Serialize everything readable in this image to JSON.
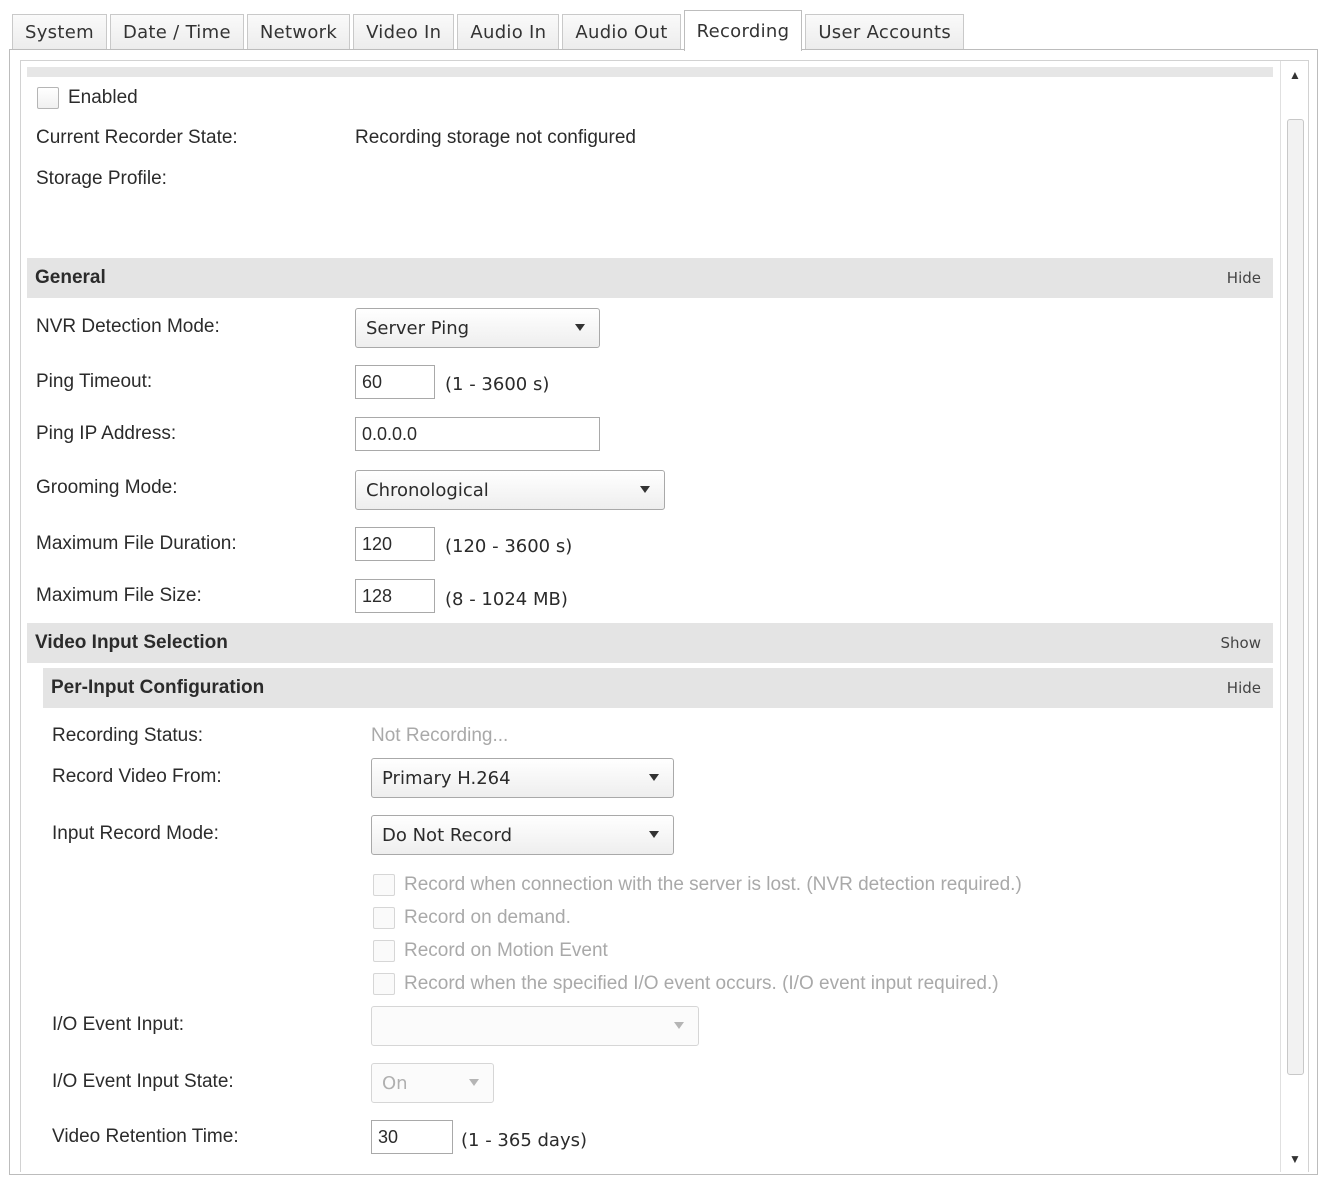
{
  "tabs": [
    {
      "label": "System",
      "active": false
    },
    {
      "label": "Date / Time",
      "active": false
    },
    {
      "label": "Network",
      "active": false
    },
    {
      "label": "Video In",
      "active": false
    },
    {
      "label": "Audio In",
      "active": false
    },
    {
      "label": "Audio Out",
      "active": false
    },
    {
      "label": "Recording",
      "active": true
    },
    {
      "label": "User Accounts",
      "active": false
    }
  ],
  "top": {
    "enabled_label": "Enabled",
    "recorder_state_label": "Current Recorder State:",
    "recorder_state_value": "Recording storage not configured",
    "storage_profile_label": "Storage Profile:"
  },
  "general": {
    "title": "General",
    "toggle": "Hide",
    "nvr_mode_label": "NVR Detection Mode:",
    "nvr_mode_value": "Server Ping",
    "ping_timeout_label": "Ping Timeout:",
    "ping_timeout_value": "60",
    "ping_timeout_range": "(1 - 3600 s)",
    "ping_ip_label": "Ping IP Address:",
    "ping_ip_value": "0.0.0.0",
    "grooming_label": "Grooming Mode:",
    "grooming_value": "Chronological",
    "max_duration_label": "Maximum File Duration:",
    "max_duration_value": "120",
    "max_duration_range": "(120 - 3600 s)",
    "max_size_label": "Maximum File Size:",
    "max_size_value": "128",
    "max_size_range": "(8 - 1024 MB)"
  },
  "video_input": {
    "title": "Video Input Selection",
    "toggle": "Show"
  },
  "per_input": {
    "title": "Per-Input Configuration",
    "toggle": "Hide",
    "status_label": "Recording Status:",
    "status_value": "Not Recording...",
    "record_from_label": "Record Video From:",
    "record_from_value": "Primary H.264",
    "record_mode_label": "Input Record Mode:",
    "record_mode_value": "Do Not Record",
    "options": [
      "Record when connection with the server is lost.  (NVR detection required.)",
      "Record on demand.",
      "Record on Motion Event",
      "Record when the specified I/O event occurs.  (I/O event input required.)"
    ],
    "io_input_label": "I/O Event Input:",
    "io_input_value": "",
    "io_state_label": "I/O Event Input State:",
    "io_state_value": "On",
    "retention_label": "Video Retention Time:",
    "retention_value": "30",
    "retention_range": "(1 - 365 days)"
  }
}
